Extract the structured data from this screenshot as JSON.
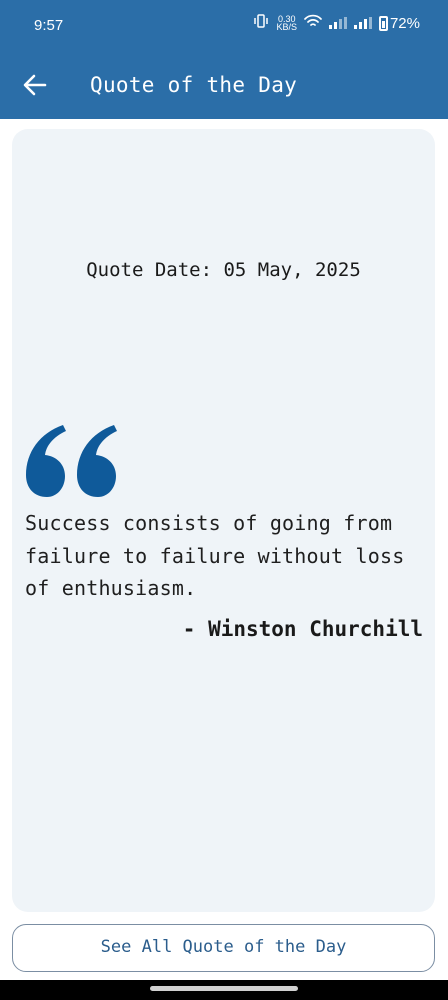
{
  "status_bar": {
    "time": "9:57",
    "net_speed_value": "0.30",
    "net_speed_unit": "KB/S",
    "battery": "72%"
  },
  "app_bar": {
    "title": "Quote of the Day",
    "back_icon": "arrow-left-icon",
    "background_color": "#2b6ea8"
  },
  "quote": {
    "date_label": "Quote Date: 05 May, 2025",
    "quote_icon": "quote-mark-icon",
    "text": "Success consists of going from failure to failure without loss of enthusiasm.",
    "author": "- Winston Churchill",
    "accent_color": "#0f5a9a"
  },
  "footer": {
    "see_all_label": "See All Quote of the Day"
  }
}
